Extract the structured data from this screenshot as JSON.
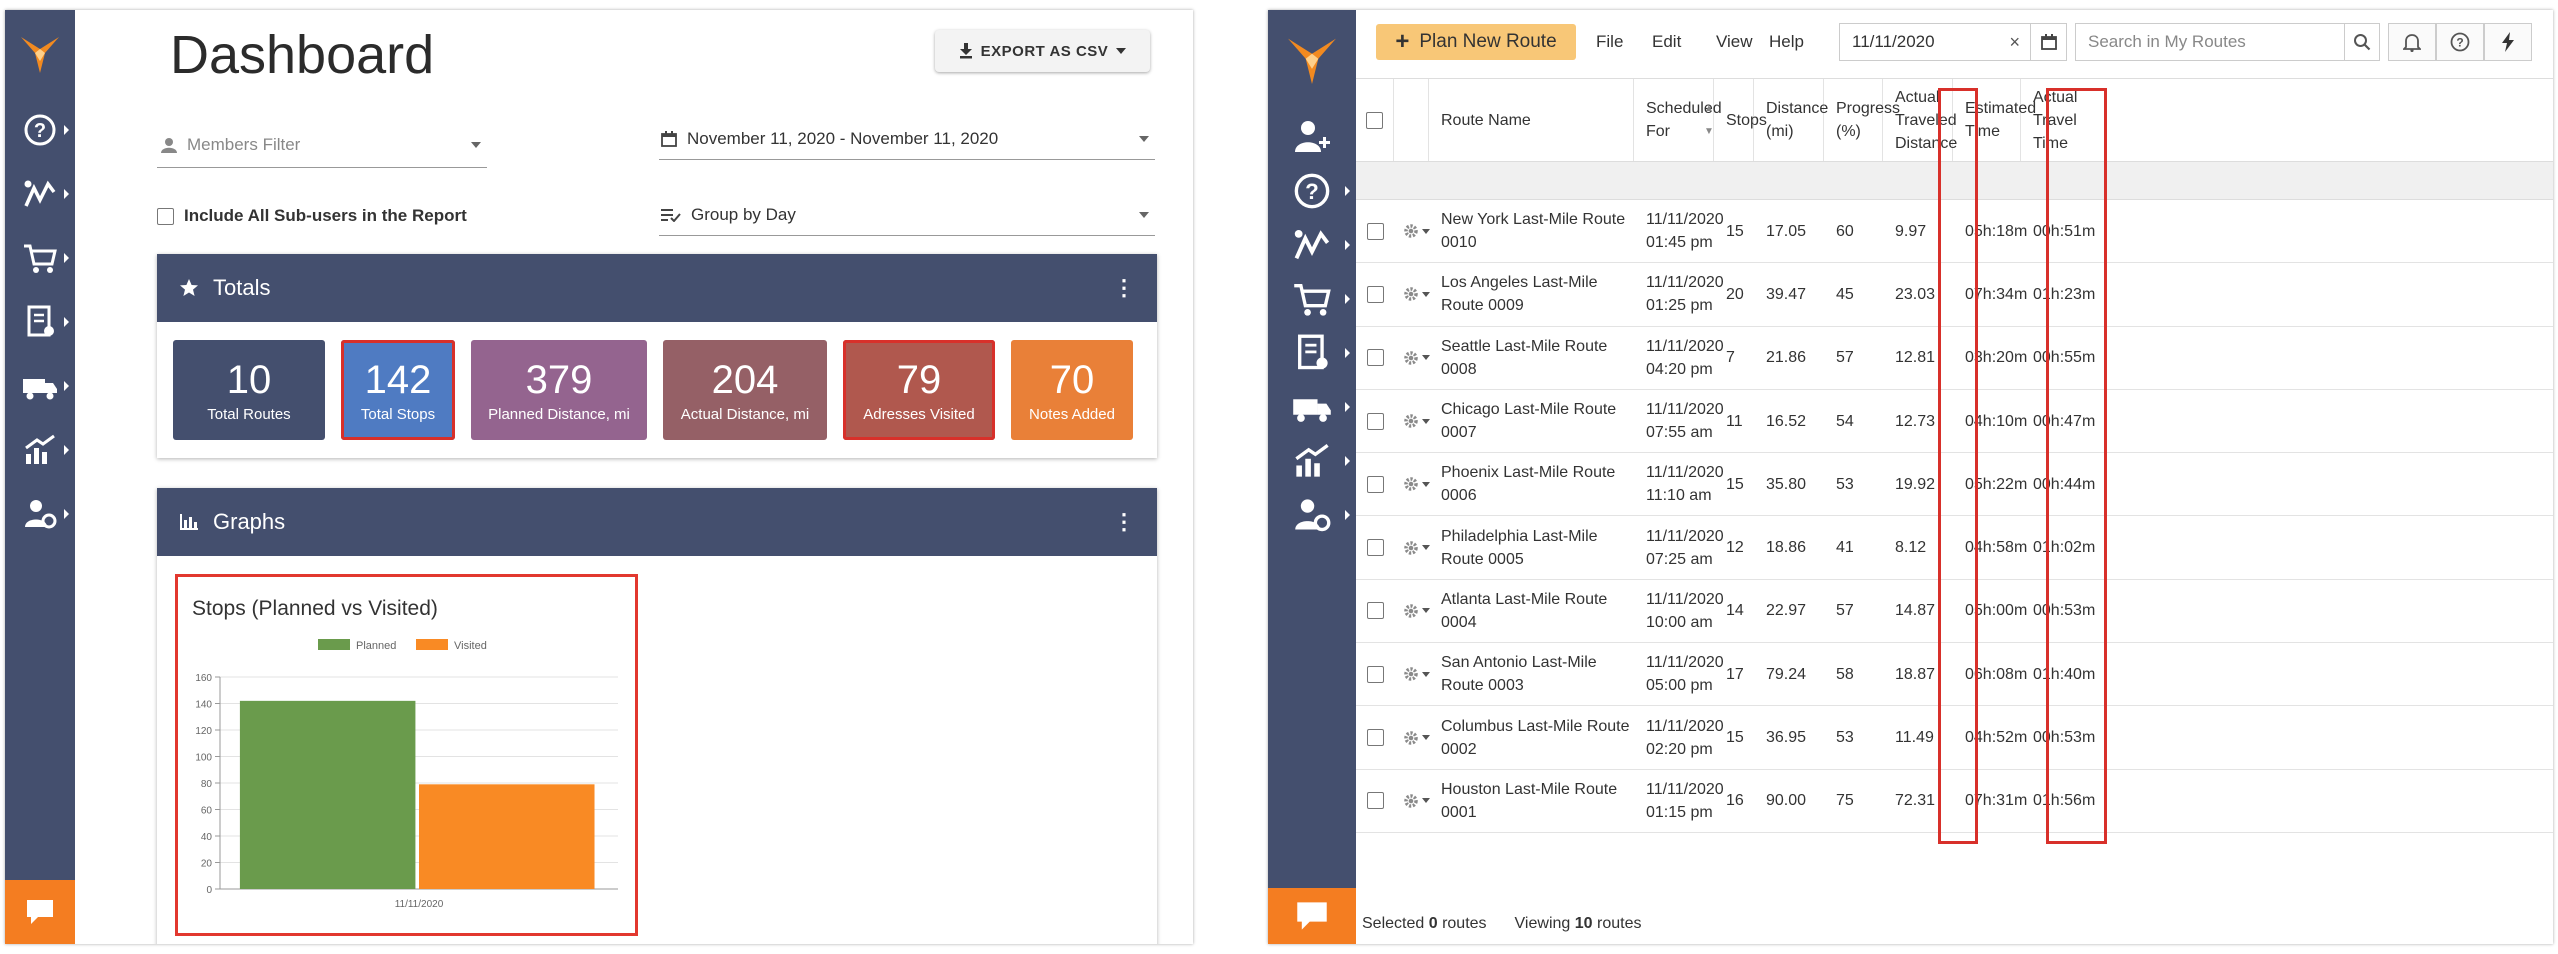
{
  "left_panel": {
    "title": "Dashboard",
    "export_label": "EXPORT AS CSV",
    "members_filter_placeholder": "Members Filter",
    "date_range": "November 11, 2020 - November 11, 2020",
    "subusers_label": "Include All Sub-users in the Report",
    "group_by": "Group by Day",
    "totals_title": "Totals",
    "graphs_title": "Graphs",
    "tiles": [
      {
        "value": "10",
        "label": "Total Routes",
        "color": "#444f6e",
        "highlight": false
      },
      {
        "value": "142",
        "label": "Total Stops",
        "color": "#4f7bc2",
        "highlight": true
      },
      {
        "value": "379",
        "label": "Planned Distance, mi",
        "color": "#94648f",
        "highlight": false
      },
      {
        "value": "204",
        "label": "Actual Distance, mi",
        "color": "#956066",
        "highlight": false
      },
      {
        "value": "79",
        "label": "Adresses Visited",
        "color": "#b0584e",
        "highlight": true
      },
      {
        "value": "70",
        "label": "Notes Added",
        "color": "#e98038",
        "highlight": false
      }
    ]
  },
  "chart_data": {
    "type": "bar",
    "title": "Stops (Planned vs Visited)",
    "categories": [
      "11/11/2020"
    ],
    "series": [
      {
        "name": "Planned",
        "values": [
          142
        ],
        "color": "#6a9b4c"
      },
      {
        "name": "Visited",
        "values": [
          79
        ],
        "color": "#f98a24"
      }
    ],
    "ylim": [
      0,
      160
    ],
    "yticks": [
      0,
      20,
      40,
      60,
      80,
      100,
      120,
      140,
      160
    ],
    "legend": "top",
    "grid": true
  },
  "right_panel": {
    "plan_button": "Plan New Route",
    "menu": [
      "File",
      "Edit",
      "View",
      "Help"
    ],
    "date_value": "11/11/2020",
    "search_placeholder": "Search in My Routes",
    "columns": [
      "Route Name",
      "Scheduled For",
      "Stops",
      "Distance (mi)",
      "Progress (%)",
      "Actual Traveled Distance",
      "Estimated Time",
      "Actual Travel Time"
    ],
    "rows": [
      {
        "name": "New York Last-Mile Route 0010",
        "date": "11/11/2020",
        "time": "01:45 pm",
        "stops": "15",
        "distance": "17.05",
        "progress": "60",
        "actual": "9.97",
        "est": "05h:18m",
        "travel": "00h:51m"
      },
      {
        "name": "Los Angeles Last-Mile Route 0009",
        "date": "11/11/2020",
        "time": "01:25 pm",
        "stops": "20",
        "distance": "39.47",
        "progress": "45",
        "actual": "23.03",
        "est": "07h:34m",
        "travel": "01h:23m"
      },
      {
        "name": "Seattle Last-Mile Route 0008",
        "date": "11/11/2020",
        "time": "04:20 pm",
        "stops": "7",
        "distance": "21.86",
        "progress": "57",
        "actual": "12.81",
        "est": "03h:20m",
        "travel": "00h:55m"
      },
      {
        "name": "Chicago Last-Mile Route 0007",
        "date": "11/11/2020",
        "time": "07:55 am",
        "stops": "11",
        "distance": "16.52",
        "progress": "54",
        "actual": "12.73",
        "est": "04h:10m",
        "travel": "00h:47m"
      },
      {
        "name": "Phoenix Last-Mile Route 0006",
        "date": "11/11/2020",
        "time": "11:10 am",
        "stops": "15",
        "distance": "35.80",
        "progress": "53",
        "actual": "19.92",
        "est": "05h:22m",
        "travel": "00h:44m"
      },
      {
        "name": "Philadelphia Last-Mile Route 0005",
        "date": "11/11/2020",
        "time": "07:25 am",
        "stops": "12",
        "distance": "18.86",
        "progress": "41",
        "actual": "8.12",
        "est": "04h:58m",
        "travel": "01h:02m"
      },
      {
        "name": "Atlanta Last-Mile Route 0004",
        "date": "11/11/2020",
        "time": "10:00 am",
        "stops": "14",
        "distance": "22.97",
        "progress": "57",
        "actual": "14.87",
        "est": "05h:00m",
        "travel": "00h:53m"
      },
      {
        "name": "San Antonio Last-Mile Route 0003",
        "date": "11/11/2020",
        "time": "05:00 pm",
        "stops": "17",
        "distance": "79.24",
        "progress": "58",
        "actual": "18.87",
        "est": "06h:08m",
        "travel": "01h:40m"
      },
      {
        "name": "Columbus Last-Mile Route 0002",
        "date": "11/11/2020",
        "time": "02:20 pm",
        "stops": "15",
        "distance": "36.95",
        "progress": "53",
        "actual": "11.49",
        "est": "04h:52m",
        "travel": "00h:53m"
      },
      {
        "name": "Houston Last-Mile Route 0001",
        "date": "11/11/2020",
        "time": "01:15 pm",
        "stops": "16",
        "distance": "90.00",
        "progress": "75",
        "actual": "72.31",
        "est": "07h:31m",
        "travel": "01h:56m"
      }
    ],
    "status": {
      "selected_prefix": "Selected",
      "selected_count": "0",
      "selected_suffix": "routes",
      "viewing_prefix": "Viewing",
      "viewing_count": "10",
      "viewing_suffix": "routes"
    }
  }
}
